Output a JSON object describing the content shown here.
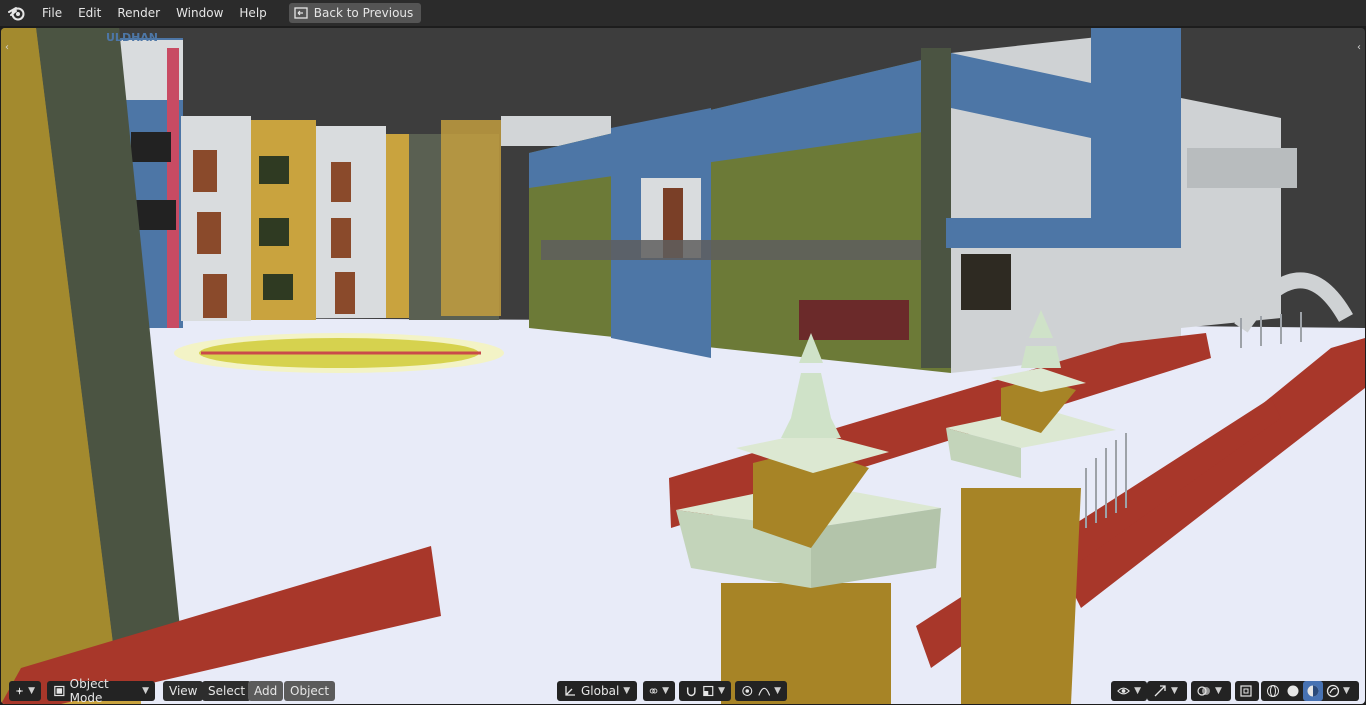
{
  "menu": {
    "file": "File",
    "edit": "Edit",
    "render": "Render",
    "window": "Window",
    "help": "Help",
    "back_to_previous": "Back to Previous"
  },
  "viewport_header": {
    "mode": "Object Mode",
    "view": "View",
    "select": "Select",
    "add": "Add",
    "object": "Object",
    "transform_orientation": "Global"
  },
  "scene_signage": "ULDHAN",
  "colors": {
    "accent": "#4772b3",
    "ground": "#e8ebf8",
    "wall_blue": "#4d76a6",
    "wall_yellow": "#c9a33e",
    "wall_green": "#6c7a37",
    "wall_grey": "#cfd2d4",
    "trim_red": "#a8372a",
    "pillar_gold": "#a78426",
    "cap_mint": "#cfe2c8",
    "dark_green": "#4b5442"
  },
  "icons": {
    "app": "blender-logo-icon",
    "back": "back-window-icon",
    "editor_type": "view3d-editor-icon",
    "mode": "object-mode-icon",
    "orientation": "axis-orientation-icon",
    "pivot": "pivot-link-icon",
    "snap": "snap-magnet-icon",
    "snap_target": "snap-increment-icon",
    "proportional": "proportional-edit-icon",
    "falloff": "falloff-curve-icon",
    "visibility": "eye-visibility-icon",
    "gizmo": "gizmo-arrows-icon",
    "overlay": "overlay-circles-icon",
    "xray": "xray-toggle-icon",
    "shading_wire": "wireframe-shading-icon",
    "shading_solid": "solid-shading-icon",
    "shading_material": "material-shading-icon",
    "shading_rendered": "rendered-shading-icon"
  }
}
